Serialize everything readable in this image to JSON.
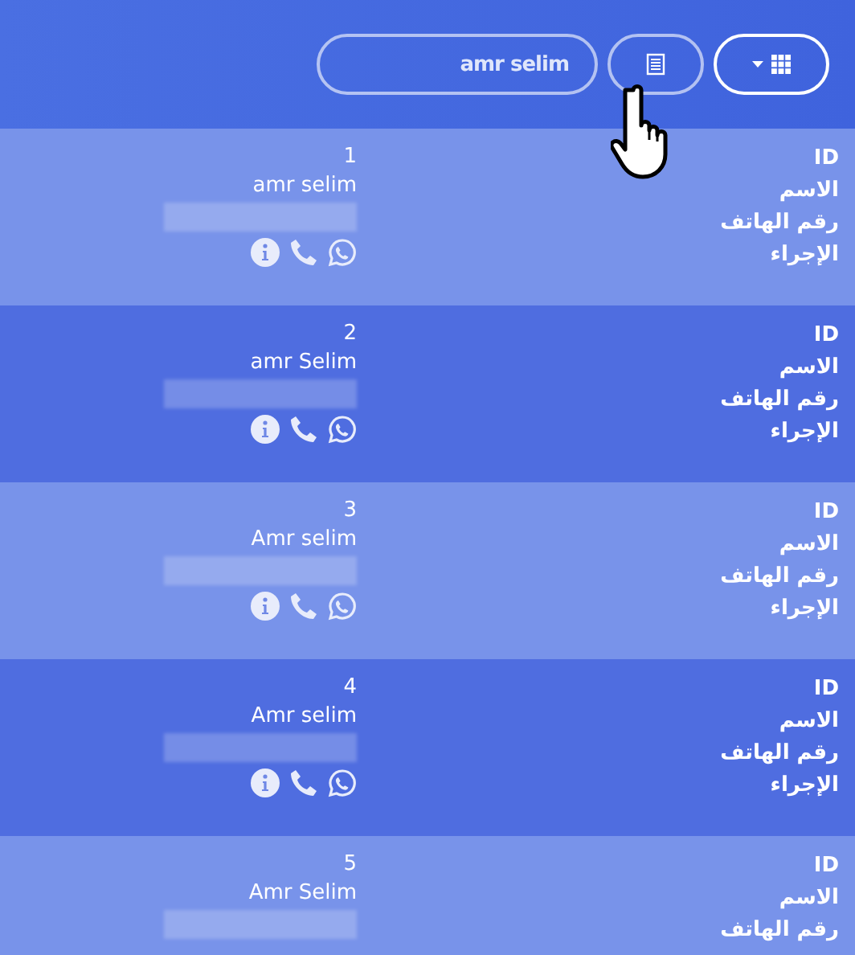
{
  "toolbar": {
    "search": {
      "value": "amr selim"
    }
  },
  "rows": [
    {
      "labels": [
        "ID",
        "الاسم",
        "رقم الهاتف",
        "الإجراء"
      ],
      "id": "1",
      "name": "amr selim",
      "actions": [
        {
          "kind": "info"
        },
        {
          "kind": "call"
        },
        {
          "kind": "whatsapp"
        }
      ]
    },
    {
      "labels": [
        "ID",
        "الاسم",
        "رقم الهاتف",
        "الإجراء"
      ],
      "id": "2",
      "name": "amr Selim",
      "actions": [
        {
          "kind": "info"
        },
        {
          "kind": "call"
        },
        {
          "kind": "whatsapp"
        }
      ]
    },
    {
      "labels": [
        "ID",
        "الاسم",
        "رقم الهاتف",
        "الإجراء"
      ],
      "id": "3",
      "name": "Amr selim",
      "actions": [
        {
          "kind": "info"
        },
        {
          "kind": "call"
        },
        {
          "kind": "whatsapp"
        }
      ]
    },
    {
      "labels": [
        "ID",
        "الاسم",
        "رقم الهاتف",
        "الإجراء"
      ],
      "id": "4",
      "name": "Amr selim",
      "actions": [
        {
          "kind": "info"
        },
        {
          "kind": "call"
        },
        {
          "kind": "whatsapp"
        }
      ]
    },
    {
      "labels": [
        "ID",
        "الاسم",
        "رقم الهاتف"
      ],
      "id": "5",
      "name": "Amr Selim"
    }
  ]
}
